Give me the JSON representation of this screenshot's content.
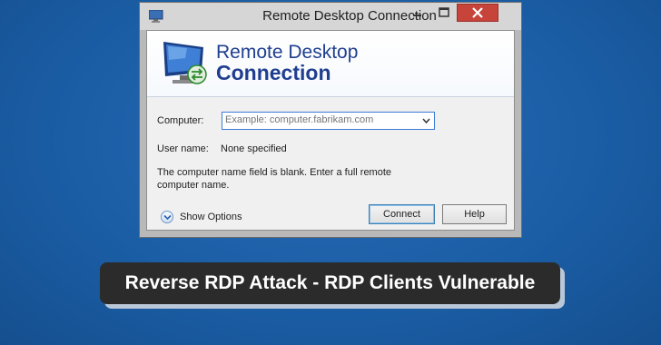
{
  "window": {
    "title": "Remote Desktop Connection",
    "controls": {
      "minimize": "minimize",
      "maximize": "maximize",
      "close": "close"
    }
  },
  "banner": {
    "line1": "Remote Desktop",
    "line2": "Connection",
    "icon": "monitor-connection-icon"
  },
  "form": {
    "computer_label": "Computer:",
    "computer_placeholder": "Example: computer.fabrikam.com",
    "computer_value": "",
    "username_label": "User name:",
    "username_value": "None specified",
    "message": "The computer name field is blank. Enter a full remote computer name."
  },
  "footer": {
    "show_options_label": "Show Options",
    "connect_label": "Connect",
    "help_label": "Help"
  },
  "headline": {
    "text": "Reverse RDP Attack - RDP Clients Vulnerable"
  },
  "colors": {
    "background": "#1b5ea6",
    "title_text": "#1f3e8f",
    "close_button": "#c7443a",
    "headline_bg": "#2b2b2b"
  }
}
